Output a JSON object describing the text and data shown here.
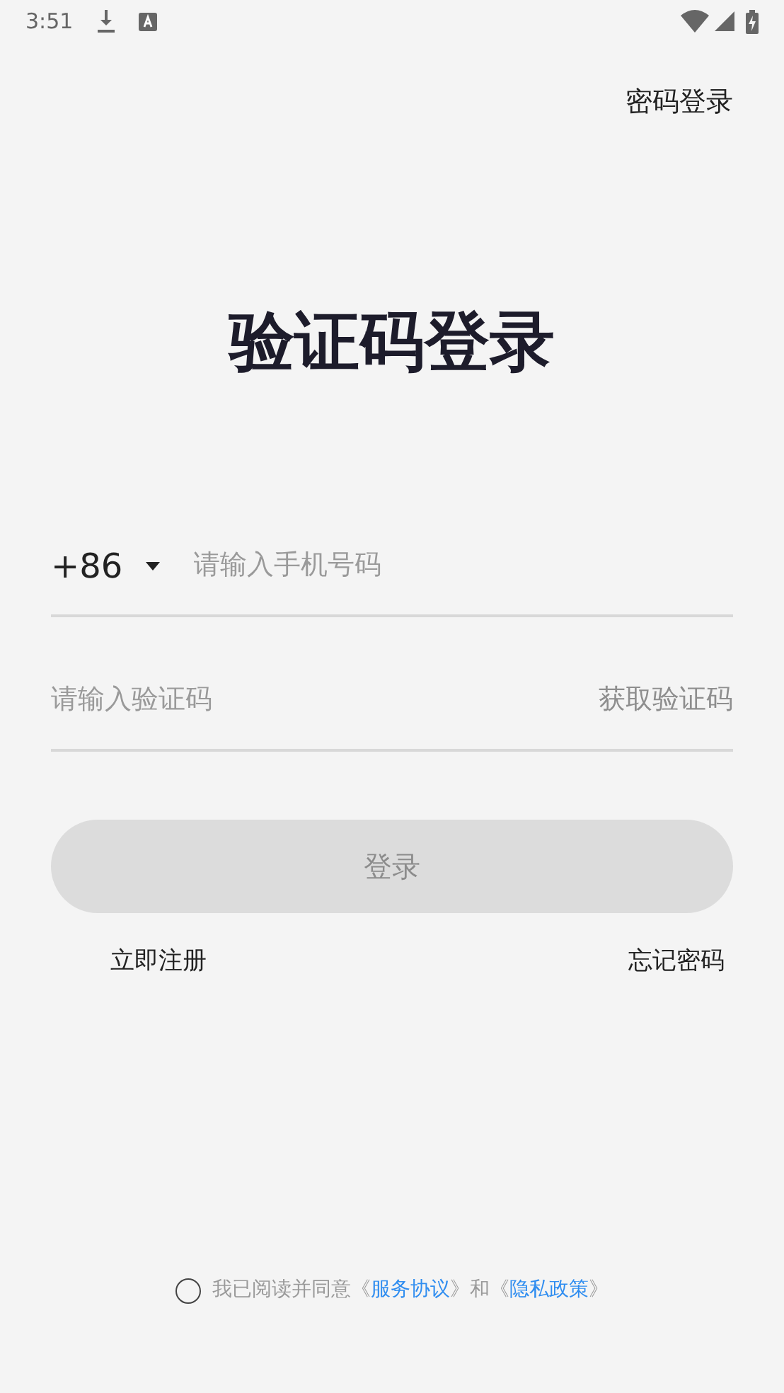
{
  "status_bar": {
    "time": "3:51"
  },
  "top_link": "密码登录",
  "title": "验证码登录",
  "phone": {
    "country_code": "+86",
    "placeholder": "请输入手机号码"
  },
  "code": {
    "placeholder": "请输入验证码",
    "action": "获取验证码"
  },
  "login_button": {
    "label": "登录",
    "disabled": true
  },
  "links": [
    "立即注册",
    "忘记密码"
  ],
  "agreement": {
    "checked": false,
    "parts": [
      {
        "kind": "text",
        "text": "我已阅读并同意《"
      },
      {
        "kind": "link",
        "text": "服务协议"
      },
      {
        "kind": "text",
        "text": "》和《"
      },
      {
        "kind": "link",
        "text": "隐私政策"
      },
      {
        "kind": "text",
        "text": "》"
      }
    ]
  }
}
